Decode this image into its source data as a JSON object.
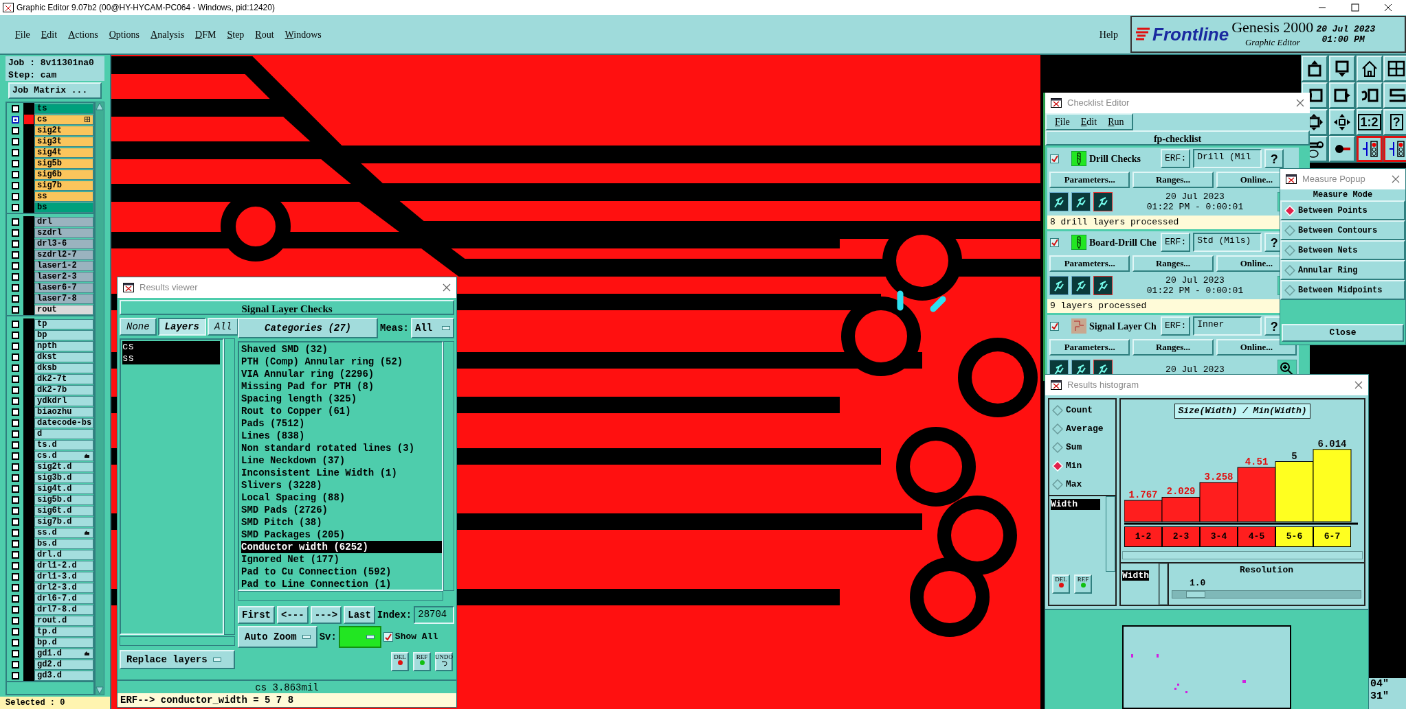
{
  "window": {
    "title": "Graphic Editor 9.07b2 (00@HY-HYCAM-PC064 - Windows, pid:12420)"
  },
  "menu": [
    "File",
    "Edit",
    "Actions",
    "Options",
    "Analysis",
    "DFM",
    "Step",
    "Rout",
    "Windows"
  ],
  "help": "Help",
  "logo": {
    "brand": "Frontline",
    "product": "Genesis 2000",
    "subtitle": "Graphic Editor",
    "date": "20 Jul 2023",
    "time": "01:00 PM"
  },
  "job_panel": {
    "job": "Job : 8v11301na0",
    "step": "Step: cam",
    "matrix_button": "Job Matrix ...",
    "selected_count": "Selected : 0",
    "layer_groups": [
      {
        "layers": [
          {
            "name": "ts",
            "color": "#00a07c",
            "selected": false
          },
          {
            "name": "cs",
            "color": "#fbc55c",
            "selected": true,
            "kind": "grid"
          },
          {
            "name": "sig2t",
            "color": "#fbc55c",
            "selected": false
          },
          {
            "name": "sig3t",
            "color": "#fbc55c",
            "selected": false
          },
          {
            "name": "sig4t",
            "color": "#fbc55c",
            "selected": false
          },
          {
            "name": "sig5b",
            "color": "#fbc55c",
            "selected": false
          },
          {
            "name": "sig6b",
            "color": "#fbc55c",
            "selected": false
          },
          {
            "name": "sig7b",
            "color": "#fbc55c",
            "selected": false
          },
          {
            "name": "ss",
            "color": "#fbc55c",
            "selected": false
          },
          {
            "name": "bs",
            "color": "#00a07c",
            "selected": false
          }
        ]
      },
      {
        "layers": [
          {
            "name": "drl",
            "color": "#9ab3bf",
            "selected": false
          },
          {
            "name": "szdrl",
            "color": "#9ab3bf",
            "selected": false
          },
          {
            "name": "drl3-6",
            "color": "#9ab3bf",
            "selected": false
          },
          {
            "name": "szdrl2-7",
            "color": "#9ab3bf",
            "selected": false
          },
          {
            "name": "laser1-2",
            "color": "#9ab3bf",
            "selected": false
          },
          {
            "name": "laser2-3",
            "color": "#9ab3bf",
            "selected": false
          },
          {
            "name": "laser6-7",
            "color": "#9ab3bf",
            "selected": false
          },
          {
            "name": "laser7-8",
            "color": "#9ab3bf",
            "selected": false
          },
          {
            "name": "rout",
            "color": "#dadada",
            "selected": false
          }
        ]
      },
      {
        "layers": [
          {
            "name": "tp",
            "color": "#a4dede",
            "selected": false
          },
          {
            "name": "bp",
            "color": "#a4dede",
            "selected": false
          },
          {
            "name": "npth",
            "color": "#a4dede",
            "selected": false
          },
          {
            "name": "dkst",
            "color": "#a4dede",
            "selected": false
          },
          {
            "name": "dksb",
            "color": "#a4dede",
            "selected": false
          },
          {
            "name": "dk2-7t",
            "color": "#a4dede",
            "selected": false
          },
          {
            "name": "dk2-7b",
            "color": "#a4dede",
            "selected": false
          },
          {
            "name": "ydkdrl",
            "color": "#a4dede",
            "selected": false
          },
          {
            "name": "biaozhu",
            "color": "#a4dede",
            "selected": false
          },
          {
            "name": "datecode-bs",
            "color": "#a4dede",
            "selected": false
          },
          {
            "name": "d",
            "color": "#a4dede",
            "selected": false
          },
          {
            "name": "ts.d",
            "color": "#a4dede",
            "selected": false
          },
          {
            "name": "cs.d",
            "color": "#a4dede",
            "selected": false,
            "kind": "hand"
          },
          {
            "name": "sig2t.d",
            "color": "#a4dede",
            "selected": false
          },
          {
            "name": "sig3b.d",
            "color": "#a4dede",
            "selected": false
          },
          {
            "name": "sig4t.d",
            "color": "#a4dede",
            "selected": false
          },
          {
            "name": "sig5b.d",
            "color": "#a4dede",
            "selected": false
          },
          {
            "name": "sig6t.d",
            "color": "#a4dede",
            "selected": false
          },
          {
            "name": "sig7b.d",
            "color": "#a4dede",
            "selected": false
          },
          {
            "name": "ss.d",
            "color": "#a4dede",
            "selected": false,
            "kind": "hand"
          },
          {
            "name": "bs.d",
            "color": "#a4dede",
            "selected": false
          },
          {
            "name": "drl.d",
            "color": "#a4dede",
            "selected": false
          },
          {
            "name": "drl1-2.d",
            "color": "#a4dede",
            "selected": false
          },
          {
            "name": "drl1-3.d",
            "color": "#a4dede",
            "selected": false
          },
          {
            "name": "drl2-3.d",
            "color": "#a4dede",
            "selected": false
          },
          {
            "name": "drl6-7.d",
            "color": "#a4dede",
            "selected": false
          },
          {
            "name": "drl7-8.d",
            "color": "#a4dede",
            "selected": false
          },
          {
            "name": "rout.d",
            "color": "#a4dede",
            "selected": false
          },
          {
            "name": "tp.d",
            "color": "#a4dede",
            "selected": false
          },
          {
            "name": "bp.d",
            "color": "#a4dede",
            "selected": false
          },
          {
            "name": "gd1.d",
            "color": "#a4dede",
            "selected": false,
            "kind": "hand"
          },
          {
            "name": "gd2.d",
            "color": "#a4dede",
            "selected": false
          },
          {
            "name": "gd3.d",
            "color": "#a4dede",
            "selected": false
          }
        ]
      }
    ]
  },
  "toolbar": [
    {
      "kind": "box-up"
    },
    {
      "kind": "box-down"
    },
    {
      "kind": "house"
    },
    {
      "kind": "grid"
    },
    {
      "kind": "box-left"
    },
    {
      "kind": "box-right"
    },
    {
      "kind": "undo-box"
    },
    {
      "kind": "s-curve"
    },
    {
      "kind": "resize"
    },
    {
      "kind": "move"
    },
    {
      "kind": "text",
      "label": "1:2"
    },
    {
      "kind": "text",
      "label": "?"
    },
    {
      "kind": "wrench"
    },
    {
      "kind": "trace"
    },
    {
      "kind": "circuit"
    },
    {
      "kind": "circuit"
    }
  ],
  "results_viewer": {
    "title": "Results viewer",
    "heading": "Signal Layer Checks",
    "layer_buttons": [
      {
        "label": "None",
        "selected": false
      },
      {
        "label": "Layers",
        "selected": true
      },
      {
        "label": "All",
        "selected": false
      }
    ],
    "categories_button": "Categories (27)",
    "meas_label": "Meas:",
    "meas_value": "All",
    "layers": [
      {
        "name": "cs",
        "selected": true
      },
      {
        "name": "ss",
        "selected": true
      }
    ],
    "categories": [
      {
        "label": "Shaved SMD (32)",
        "selected": false
      },
      {
        "label": "PTH (Comp) Annular ring (52)",
        "selected": false
      },
      {
        "label": "VIA Annular ring (2296)",
        "selected": false
      },
      {
        "label": "Missing Pad for PTH (8)",
        "selected": false
      },
      {
        "label": "Spacing length (325)",
        "selected": false
      },
      {
        "label": "Rout to Copper (61)",
        "selected": false
      },
      {
        "label": "Pads (7512)",
        "selected": false
      },
      {
        "label": "Lines (838)",
        "selected": false
      },
      {
        "label": "Non standard rotated lines (3)",
        "selected": false
      },
      {
        "label": "Line Neckdown (37)",
        "selected": false
      },
      {
        "label": "Inconsistent Line Width (1)",
        "selected": false
      },
      {
        "label": "Slivers (3228)",
        "selected": false
      },
      {
        "label": "Local Spacing (88)",
        "selected": false
      },
      {
        "label": "SMD Pads (2726)",
        "selected": false
      },
      {
        "label": "SMD Pitch (38)",
        "selected": false
      },
      {
        "label": "SMD Packages (205)",
        "selected": false
      },
      {
        "label": "Conductor width (6252)",
        "selected": true
      },
      {
        "label": "Ignored Net (177)",
        "selected": false
      },
      {
        "label": "Pad to Cu Connection (592)",
        "selected": false
      },
      {
        "label": "Pad to Line Connection (1)",
        "selected": false
      }
    ],
    "nav": [
      "First",
      "<---",
      "--->",
      "Last"
    ],
    "index_label": "Index:",
    "index_value": "28704",
    "zoom_mode": "Auto Zoom",
    "sv_label": "Sv:",
    "show_all": {
      "label": "Show All",
      "checked": true
    },
    "replace_layers": "Replace layers",
    "actions": [
      {
        "kind": "del",
        "label": "DEL"
      },
      {
        "kind": "ref",
        "label": "REF"
      },
      {
        "kind": "undo",
        "label": "UNDO"
      }
    ],
    "measurement": "cs 3.863mil",
    "erf_line": "ERF--> conductor_width = 5 7 8"
  },
  "checklist_editor": {
    "title": "Checklist Editor",
    "menu": [
      "File",
      "Edit",
      "Run"
    ],
    "name": "fp-checklist",
    "checks": [
      {
        "name": "Drill Checks",
        "kind": "drill",
        "checked": true,
        "erf_label": "ERF:",
        "erf": "Drill (Mil",
        "help": "?",
        "buttons": [
          "Parameters...",
          "Ranges...",
          "Online..."
        ],
        "date": "20 Jul 2023",
        "time": "01:22 PM - 0:00:01",
        "status": "8 drill layers processed"
      },
      {
        "name": "Board-Drill Che",
        "kind": "drill",
        "checked": true,
        "erf_label": "ERF:",
        "erf": "Std (Mils)",
        "help": "?",
        "buttons": [
          "Parameters...",
          "Ranges...",
          "Online..."
        ],
        "date": "20 Jul 2023",
        "time": "01:22 PM - 0:00:01",
        "status": "9 layers processed"
      },
      {
        "name": "Signal Layer Ch",
        "kind": "board",
        "checked": true,
        "erf_label": "ERF:",
        "erf": "Inner",
        "help": "?",
        "buttons": [
          "Parameters...",
          "Ranges...",
          "Online..."
        ],
        "date": "20 Jul 2023"
      }
    ]
  },
  "measure_popup": {
    "title": "Measure Popup",
    "heading": "Measure Mode",
    "options": [
      {
        "label": "Between Points",
        "selected": true
      },
      {
        "label": "Between Contours",
        "selected": false
      },
      {
        "label": "Between Nets",
        "selected": false
      },
      {
        "label": "Annular Ring",
        "selected": false
      },
      {
        "label": "Between Midpoints",
        "selected": false
      }
    ],
    "close": "Close"
  },
  "histogram": {
    "title": "Results histogram",
    "modes": [
      {
        "label": "Count",
        "selected": false
      },
      {
        "label": "Average",
        "selected": false
      },
      {
        "label": "Sum",
        "selected": false
      },
      {
        "label": "Min",
        "selected": true
      },
      {
        "label": "Max",
        "selected": false
      }
    ],
    "fields": [
      {
        "label": "Width",
        "selected": true
      }
    ],
    "del": "DEL",
    "ref": "REF",
    "chart_data": {
      "type": "bar",
      "title": "Size(Width) / Min(Width)",
      "categories": [
        "1-2",
        "2-3",
        "3-4",
        "4-5",
        "5-6",
        "6-7"
      ],
      "data_labels": true,
      "series": [
        {
          "color": "#ff1e1e",
          "values": [
            1.767,
            2.029,
            3.258,
            4.51,
            null,
            null
          ]
        },
        {
          "color": "#ffff20",
          "values": [
            null,
            null,
            null,
            null,
            5,
            6.014
          ]
        }
      ]
    },
    "bin_field": "Width",
    "resolution_label": "Resolution",
    "resolution_value": "1.0",
    "resolution": {
      "level": 0.1
    }
  },
  "coordinates": [
    "04\"",
    "31\""
  ]
}
